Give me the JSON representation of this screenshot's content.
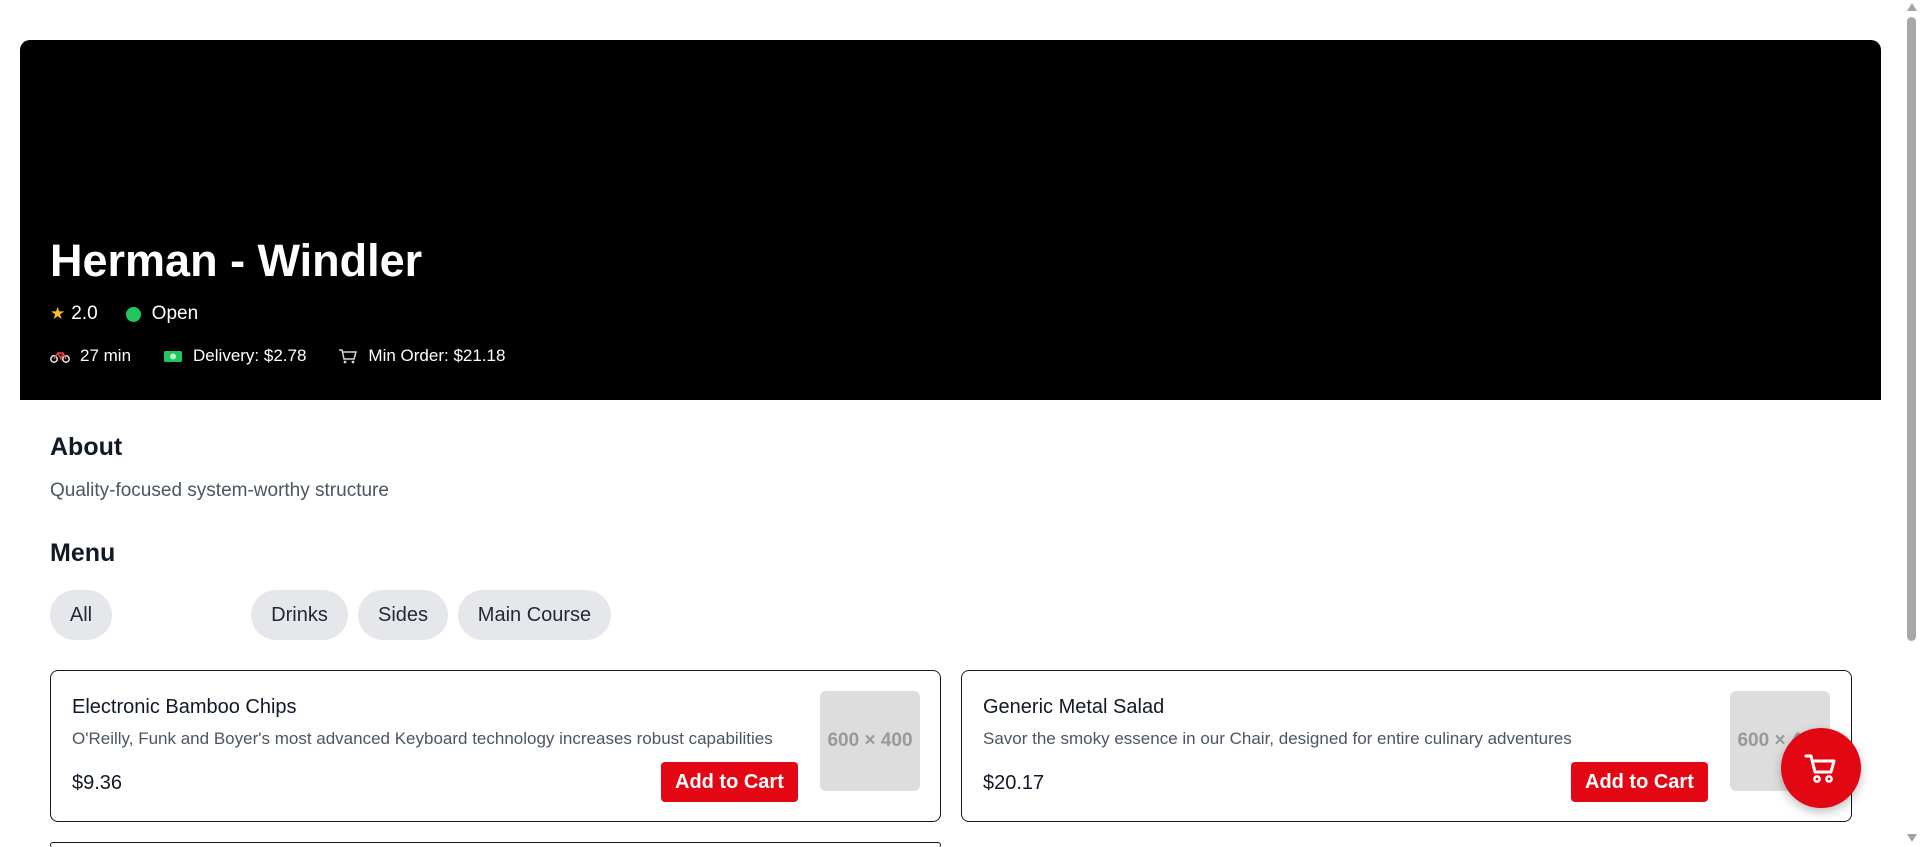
{
  "restaurant": {
    "name": "Herman - Windler",
    "rating": "2.0",
    "status": "Open",
    "delivery_time": "27 min",
    "delivery_fee": "Delivery: $2.78",
    "min_order": "Min Order: $21.18"
  },
  "about": {
    "title": "About",
    "text": "Quality-focused system-worthy structure"
  },
  "menu": {
    "title": "Menu",
    "filters": [
      "All",
      "Drinks",
      "Sides",
      "Main Course"
    ],
    "items": [
      {
        "name": "Electronic Bamboo Chips",
        "description": "O'Reilly, Funk and Boyer's most advanced Keyboard technology increases robust capabilities",
        "price": "$9.36",
        "button": "Add to Cart",
        "image_placeholder": "600 × 400"
      },
      {
        "name": "Generic Metal Salad",
        "description": "Savor the smoky essence in our Chair, designed for entire culinary adventures",
        "price": "$20.17",
        "button": "Add to Cart",
        "image_placeholder": "600 × 400"
      }
    ]
  },
  "colors": {
    "accent": "#e30613",
    "open_status": "#22c55e",
    "star": "#fbbf24",
    "hero_bg": "#000000"
  },
  "icons": {
    "rating": "star-icon",
    "delivery_time": "bicycle-icon",
    "delivery_fee": "money-icon",
    "min_order": "cart-icon",
    "cart_button": "shopping-cart-icon"
  }
}
